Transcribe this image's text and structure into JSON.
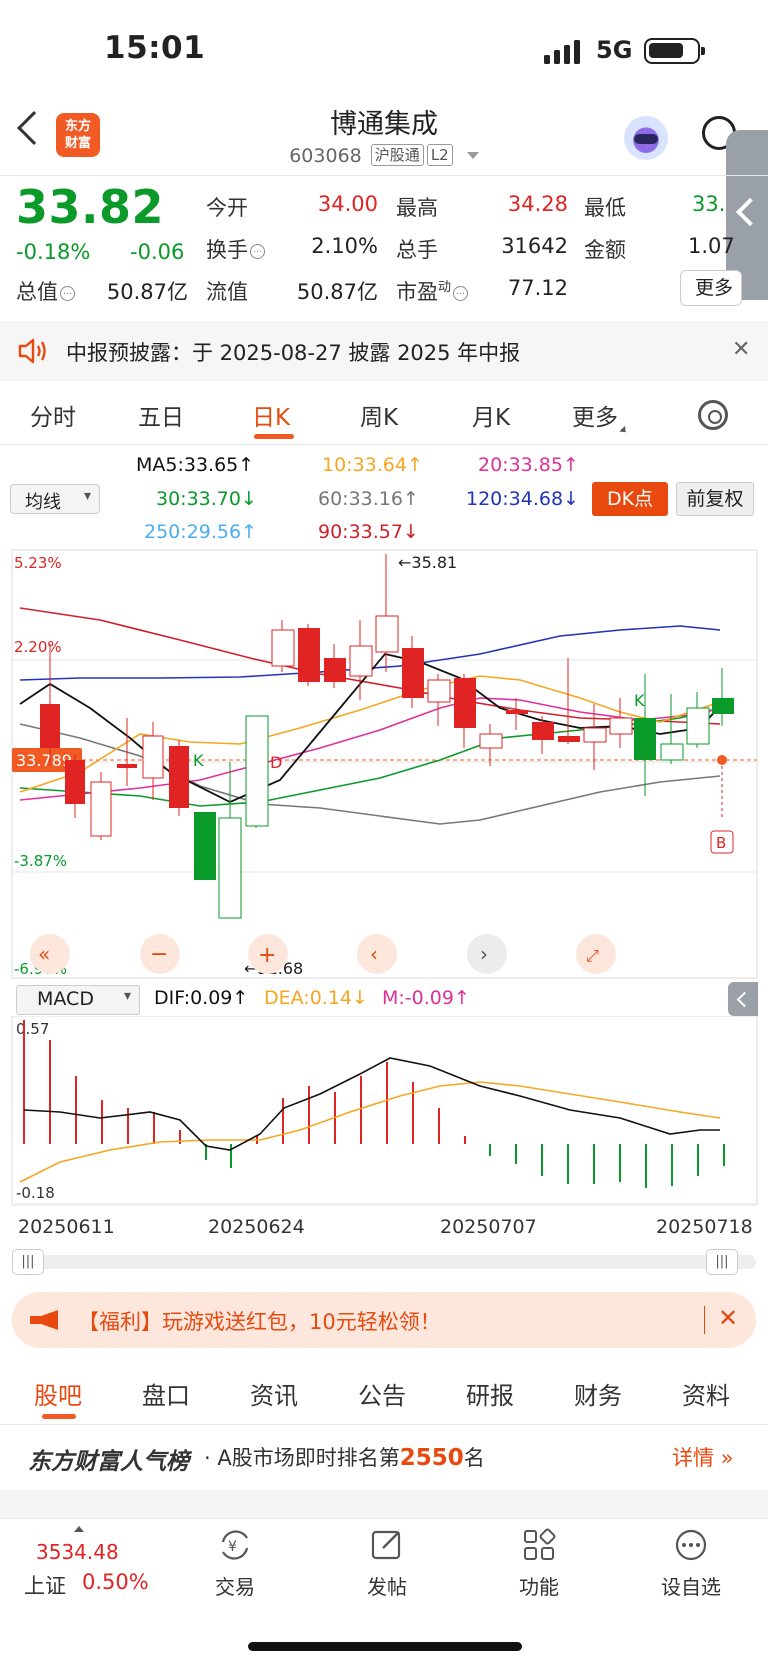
{
  "status": {
    "time": "15:01",
    "network": "5G"
  },
  "header": {
    "brand_line1": "东方",
    "brand_line2": "财富",
    "stock_name": "博通集成",
    "stock_code": "603068",
    "tag_connect": "沪股通",
    "tag_level": "L2"
  },
  "quote": {
    "price": "33.82",
    "change_pct": "-0.18%",
    "change_abs": "-0.06",
    "labels": {
      "open": "今开",
      "high": "最高",
      "low": "最低",
      "turnover": "换手",
      "volume": "总手",
      "amount": "金额",
      "total_mv": "总值",
      "float_mv": "流值",
      "pe": "市盈",
      "pe_sup": "动"
    },
    "open": "34.00",
    "high": "34.28",
    "low": "33.",
    "turnover": "2.10%",
    "volume": "31642",
    "amount": "1.07",
    "total_mv": "50.87亿",
    "float_mv": "50.87亿",
    "pe": "77.12",
    "more": "更多"
  },
  "notice": {
    "text": "中报预披露：于 2025-08-27 披露 2025 年中报"
  },
  "period_tabs": [
    "分时",
    "五日",
    "日K",
    "周K",
    "月K",
    "更多"
  ],
  "ma": {
    "selector": "均线",
    "ma5": "MA5:33.65",
    "ma10": "10:33.64",
    "ma20": "20:33.85",
    "ma30": "30:33.70",
    "ma60": "60:33.16",
    "ma120": "120:34.68",
    "ma250": "250:29.56",
    "ma90": "90:33.57",
    "dk_button": "DK点",
    "adjust_button": "前复权"
  },
  "kline": {
    "pct_labels": [
      "5.23%",
      "2.20%",
      "-3.87%",
      "-6.90%"
    ],
    "current_tag": "33.789",
    "high_annot": "35.81",
    "low_annot": "31.68",
    "marker_k": "K",
    "marker_d": "D",
    "marker_b": "B"
  },
  "macd": {
    "selector": "MACD",
    "dif": "DIF:0.09",
    "dea": "DEA:0.14",
    "m": "M:-0.09",
    "ymax": "0.57",
    "ymin": "-0.18"
  },
  "dates": [
    "20250611",
    "20250624",
    "20250707",
    "20250718"
  ],
  "chart_data": {
    "type": "candlestick",
    "ma_labels": [
      "MA5",
      "MA10",
      "MA20",
      "MA30",
      "MA60",
      "MA120",
      "MA250",
      "MA90"
    ],
    "macd_last": {
      "dif": 0.09,
      "dea": 0.14,
      "m": -0.09
    },
    "price_annotations": {
      "high": 35.81,
      "low": 31.68,
      "current": 33.789
    }
  },
  "promo": {
    "text": "【福利】玩游戏送红包，10元轻松领！"
  },
  "bottom_tabs": [
    "股吧",
    "盘口",
    "资讯",
    "公告",
    "研报",
    "财务",
    "资料"
  ],
  "popularity": {
    "brand": "东方财富人气榜",
    "prefix": "· A股市场即时排名第",
    "rank": "2550",
    "suffix": "名",
    "detail": "详情"
  },
  "bottom_nav": {
    "index_price": "3534.48",
    "index_name": "上证",
    "index_change": "0.50%",
    "items": [
      "交易",
      "发帖",
      "功能",
      "设自选"
    ]
  },
  "colors": {
    "up": "#e02424",
    "down": "#0a9a2a",
    "accent": "#f25a24",
    "ma5": "#111111",
    "ma10": "#f5a623",
    "ma20": "#e0309a",
    "ma30": "#0a9a2a",
    "ma60": "#777777",
    "ma120": "#2233bb",
    "ma250": "#4aaef0",
    "ma90": "#d0202a"
  }
}
